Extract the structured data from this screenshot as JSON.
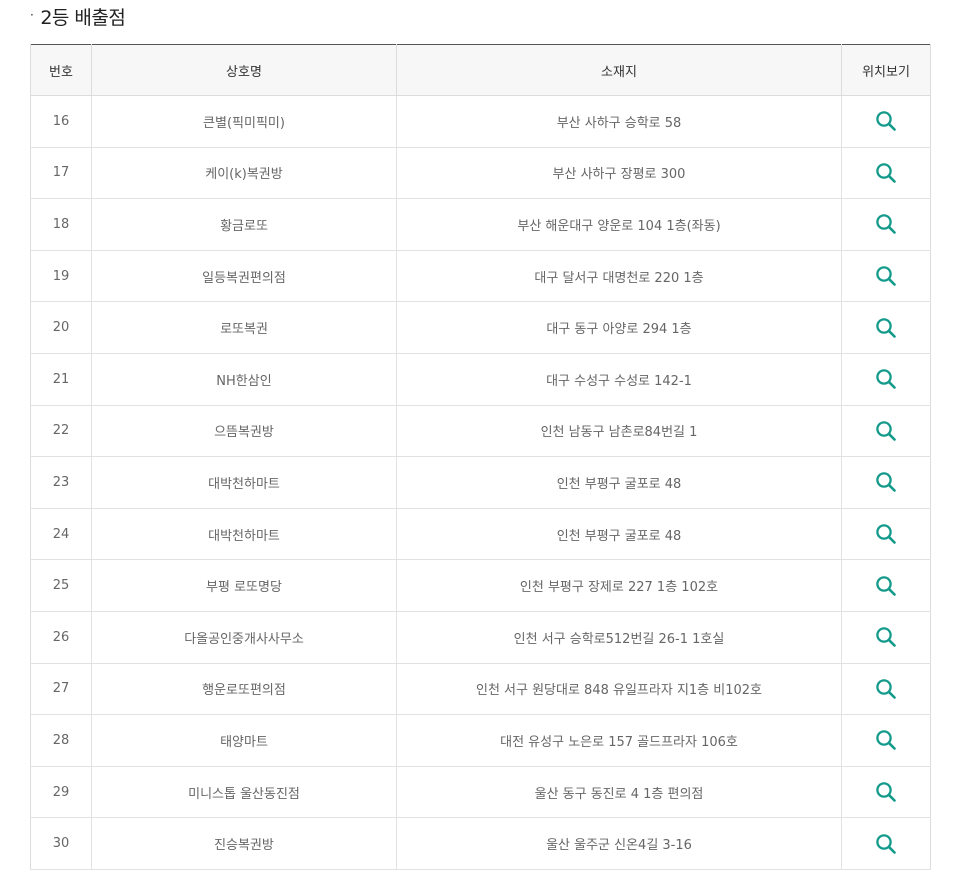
{
  "section": {
    "bullet": "·",
    "title": "2등 배출점"
  },
  "table": {
    "headers": {
      "no": "번호",
      "name": "상호명",
      "address": "소재지",
      "map": "위치보기"
    },
    "rows": [
      {
        "no": "16",
        "name": "큰별(픽미픽미)",
        "address": "부산 사하구 승학로 58",
        "map_icon": "search-icon"
      },
      {
        "no": "17",
        "name": "케이(k)복권방",
        "address": "부산 사하구 장평로 300",
        "map_icon": "search-icon"
      },
      {
        "no": "18",
        "name": "황금로또",
        "address": "부산 해운대구 양운로 104 1층(좌동)",
        "map_icon": "search-icon"
      },
      {
        "no": "19",
        "name": "일등복권편의점",
        "address": "대구 달서구 대명천로 220 1층",
        "map_icon": "search-icon"
      },
      {
        "no": "20",
        "name": "로또복권",
        "address": "대구 동구 아양로 294 1층",
        "map_icon": "search-icon"
      },
      {
        "no": "21",
        "name": "NH한삼인",
        "address": "대구 수성구 수성로 142-1",
        "map_icon": "search-icon"
      },
      {
        "no": "22",
        "name": "으뜸복권방",
        "address": "인천 남동구 남촌로84번길 1",
        "map_icon": "search-icon"
      },
      {
        "no": "23",
        "name": "대박천하마트",
        "address": "인천 부평구 굴포로 48",
        "map_icon": "search-icon"
      },
      {
        "no": "24",
        "name": "대박천하마트",
        "address": "인천 부평구 굴포로 48",
        "map_icon": "search-icon"
      },
      {
        "no": "25",
        "name": "부평 로또명당",
        "address": "인천 부평구 장제로 227 1층 102호",
        "map_icon": "search-icon"
      },
      {
        "no": "26",
        "name": "다올공인중개사사무소",
        "address": "인천 서구 승학로512번길 26-1 1호실",
        "map_icon": "search-icon"
      },
      {
        "no": "27",
        "name": "행운로또편의점",
        "address": "인천 서구 원당대로 848 유일프라자 지1층 비102호",
        "map_icon": "search-icon"
      },
      {
        "no": "28",
        "name": "태양마트",
        "address": "대전 유성구 노은로 157 골드프라자 106호",
        "map_icon": "search-icon"
      },
      {
        "no": "29",
        "name": "미니스톱 울산동진점",
        "address": "울산 동구 동진로 4 1층 편의점",
        "map_icon": "search-icon"
      },
      {
        "no": "30",
        "name": "진승복권방",
        "address": "울산 울주군 신온4길 3-16",
        "map_icon": "search-icon"
      }
    ]
  },
  "colors": {
    "accent": "#139a8b",
    "header_bg": "#f7f7f7",
    "table_top_border": "#555555"
  }
}
